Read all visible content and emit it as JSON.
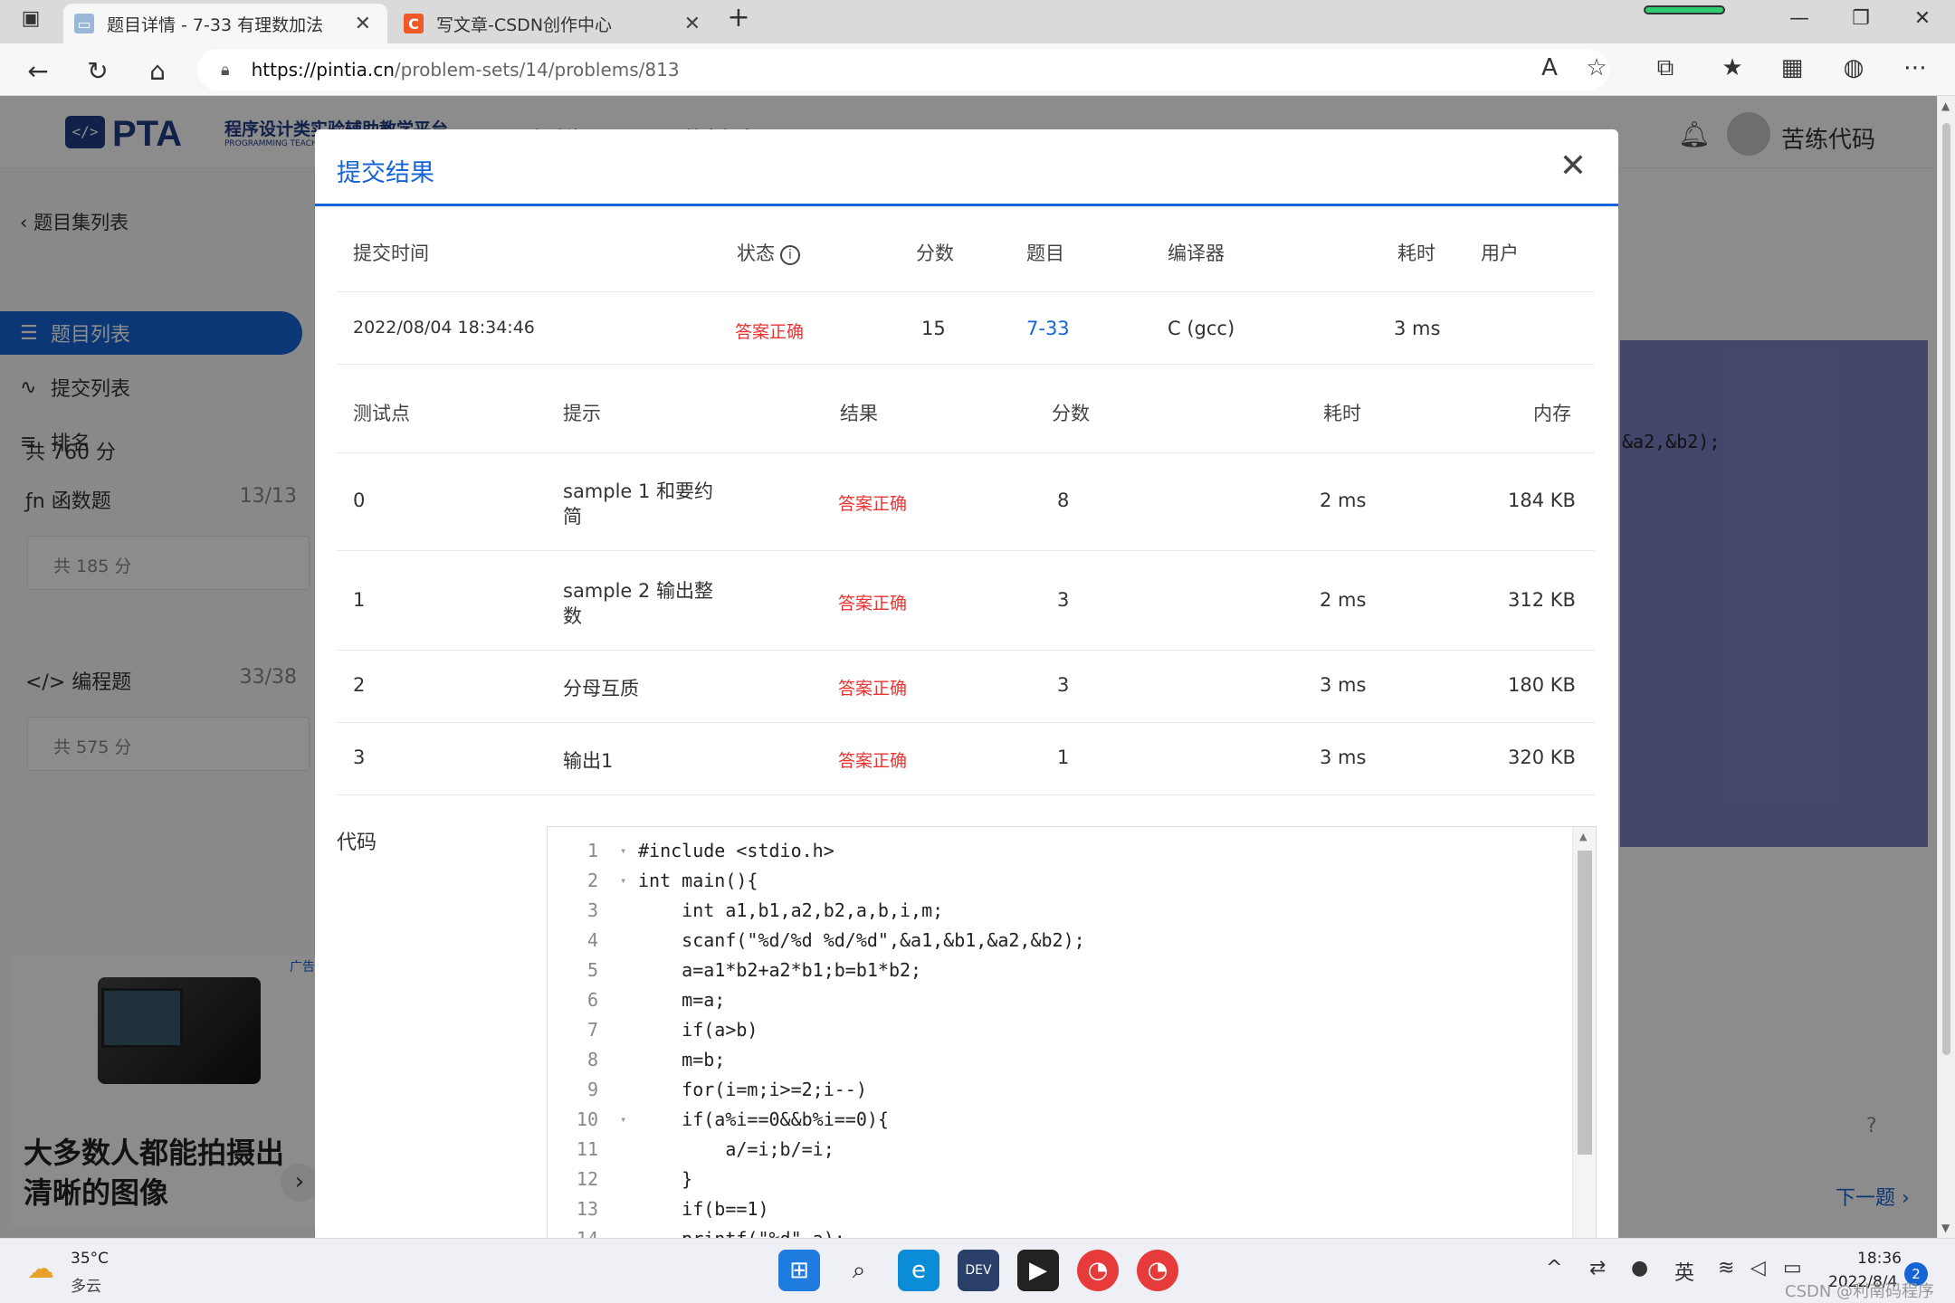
{
  "browser": {
    "tabs": [
      {
        "title": "题目详情 - 7-33 有理数加法",
        "active": true
      },
      {
        "title": "写文章-CSDN创作中心",
        "active": false
      }
    ],
    "url_host": "https://pintia.cn",
    "url_path": "/problem-sets/14/problems/813"
  },
  "site": {
    "logo_text": "PTA",
    "logo_subtitle": "程序设计类实验辅助教学平台",
    "logo_subtitle_en": "PROGRAMMING TEACHING",
    "nav_links": [
      "考试练习",
      "教育超市"
    ],
    "username": "苦练代码"
  },
  "sidebar": {
    "back_label": "题目集列表",
    "items": [
      {
        "label": "题目列表",
        "active": true
      },
      {
        "label": "提交列表",
        "active": false
      },
      {
        "label": "排名",
        "active": false
      }
    ],
    "total_score": "共 760 分",
    "categories": [
      {
        "label": "函数题",
        "count": "13/13",
        "score": "共 185 分"
      },
      {
        "label": "编程题",
        "count": "33/38",
        "score": "共 575 分"
      }
    ],
    "ad": {
      "tag": "广告",
      "text": "大多数人都能拍摄出清晰的图像"
    }
  },
  "page": {
    "editor_fragment": "&a2,&b2);",
    "next_label": "下一题"
  },
  "modal": {
    "title": "提交结果",
    "summary_headers": [
      "提交时间",
      "状态",
      "分数",
      "题目",
      "编译器",
      "耗时",
      "用户"
    ],
    "summary": {
      "time": "2022/08/04 18:34:46",
      "status": "答案正确",
      "score": "15",
      "problem": "7-33",
      "compiler": "C (gcc)",
      "elapsed": "3 ms",
      "user": ""
    },
    "test_headers": [
      "测试点",
      "提示",
      "结果",
      "分数",
      "耗时",
      "内存"
    ],
    "tests": [
      {
        "id": "0",
        "hint_l1": "sample 1 和要约",
        "hint_l2": "简",
        "result": "答案正确",
        "score": "8",
        "time": "2 ms",
        "memory": "184 KB"
      },
      {
        "id": "1",
        "hint_l1": "sample 2 输出整",
        "hint_l2": "数",
        "result": "答案正确",
        "score": "3",
        "time": "2 ms",
        "memory": "312 KB"
      },
      {
        "id": "2",
        "hint_l1": "分母互质",
        "hint_l2": "",
        "result": "答案正确",
        "score": "3",
        "time": "3 ms",
        "memory": "180 KB"
      },
      {
        "id": "3",
        "hint_l1": "输出1",
        "hint_l2": "",
        "result": "答案正确",
        "score": "1",
        "time": "3 ms",
        "memory": "320 KB"
      }
    ],
    "code_label": "代码",
    "code_lines": [
      {
        "n": "1",
        "fold": true,
        "text": "#include <stdio.h>"
      },
      {
        "n": "2",
        "fold": true,
        "text": "int main(){"
      },
      {
        "n": "3",
        "fold": false,
        "text": "    int a1,b1,a2,b2,a,b,i,m;"
      },
      {
        "n": "4",
        "fold": false,
        "text": "    scanf(\"%d/%d %d/%d\",&a1,&b1,&a2,&b2);"
      },
      {
        "n": "5",
        "fold": false,
        "text": "    a=a1*b2+a2*b1;b=b1*b2;"
      },
      {
        "n": "6",
        "fold": false,
        "text": "    m=a;"
      },
      {
        "n": "7",
        "fold": false,
        "text": "    if(a>b)"
      },
      {
        "n": "8",
        "fold": false,
        "text": "    m=b;"
      },
      {
        "n": "9",
        "fold": false,
        "text": "    for(i=m;i>=2;i--)"
      },
      {
        "n": "10",
        "fold": true,
        "text": "    if(a%i==0&&b%i==0){"
      },
      {
        "n": "11",
        "fold": false,
        "text": "        a/=i;b/=i;"
      },
      {
        "n": "12",
        "fold": false,
        "text": "    }"
      },
      {
        "n": "13",
        "fold": false,
        "text": "    if(b==1)"
      },
      {
        "n": "14",
        "fold": false,
        "text": "    printf(\"%d\",a);"
      }
    ]
  },
  "taskbar": {
    "temperature": "35°C",
    "weather": "多云",
    "ime": "英",
    "time": "18:36",
    "date": "2022/8/4",
    "notifications": "2",
    "watermark": "CSDN @利南码程序"
  },
  "colors": {
    "accent": "#1565d8",
    "success": "#ee3333",
    "overlay": "rgba(0,0,0,0.45)"
  }
}
